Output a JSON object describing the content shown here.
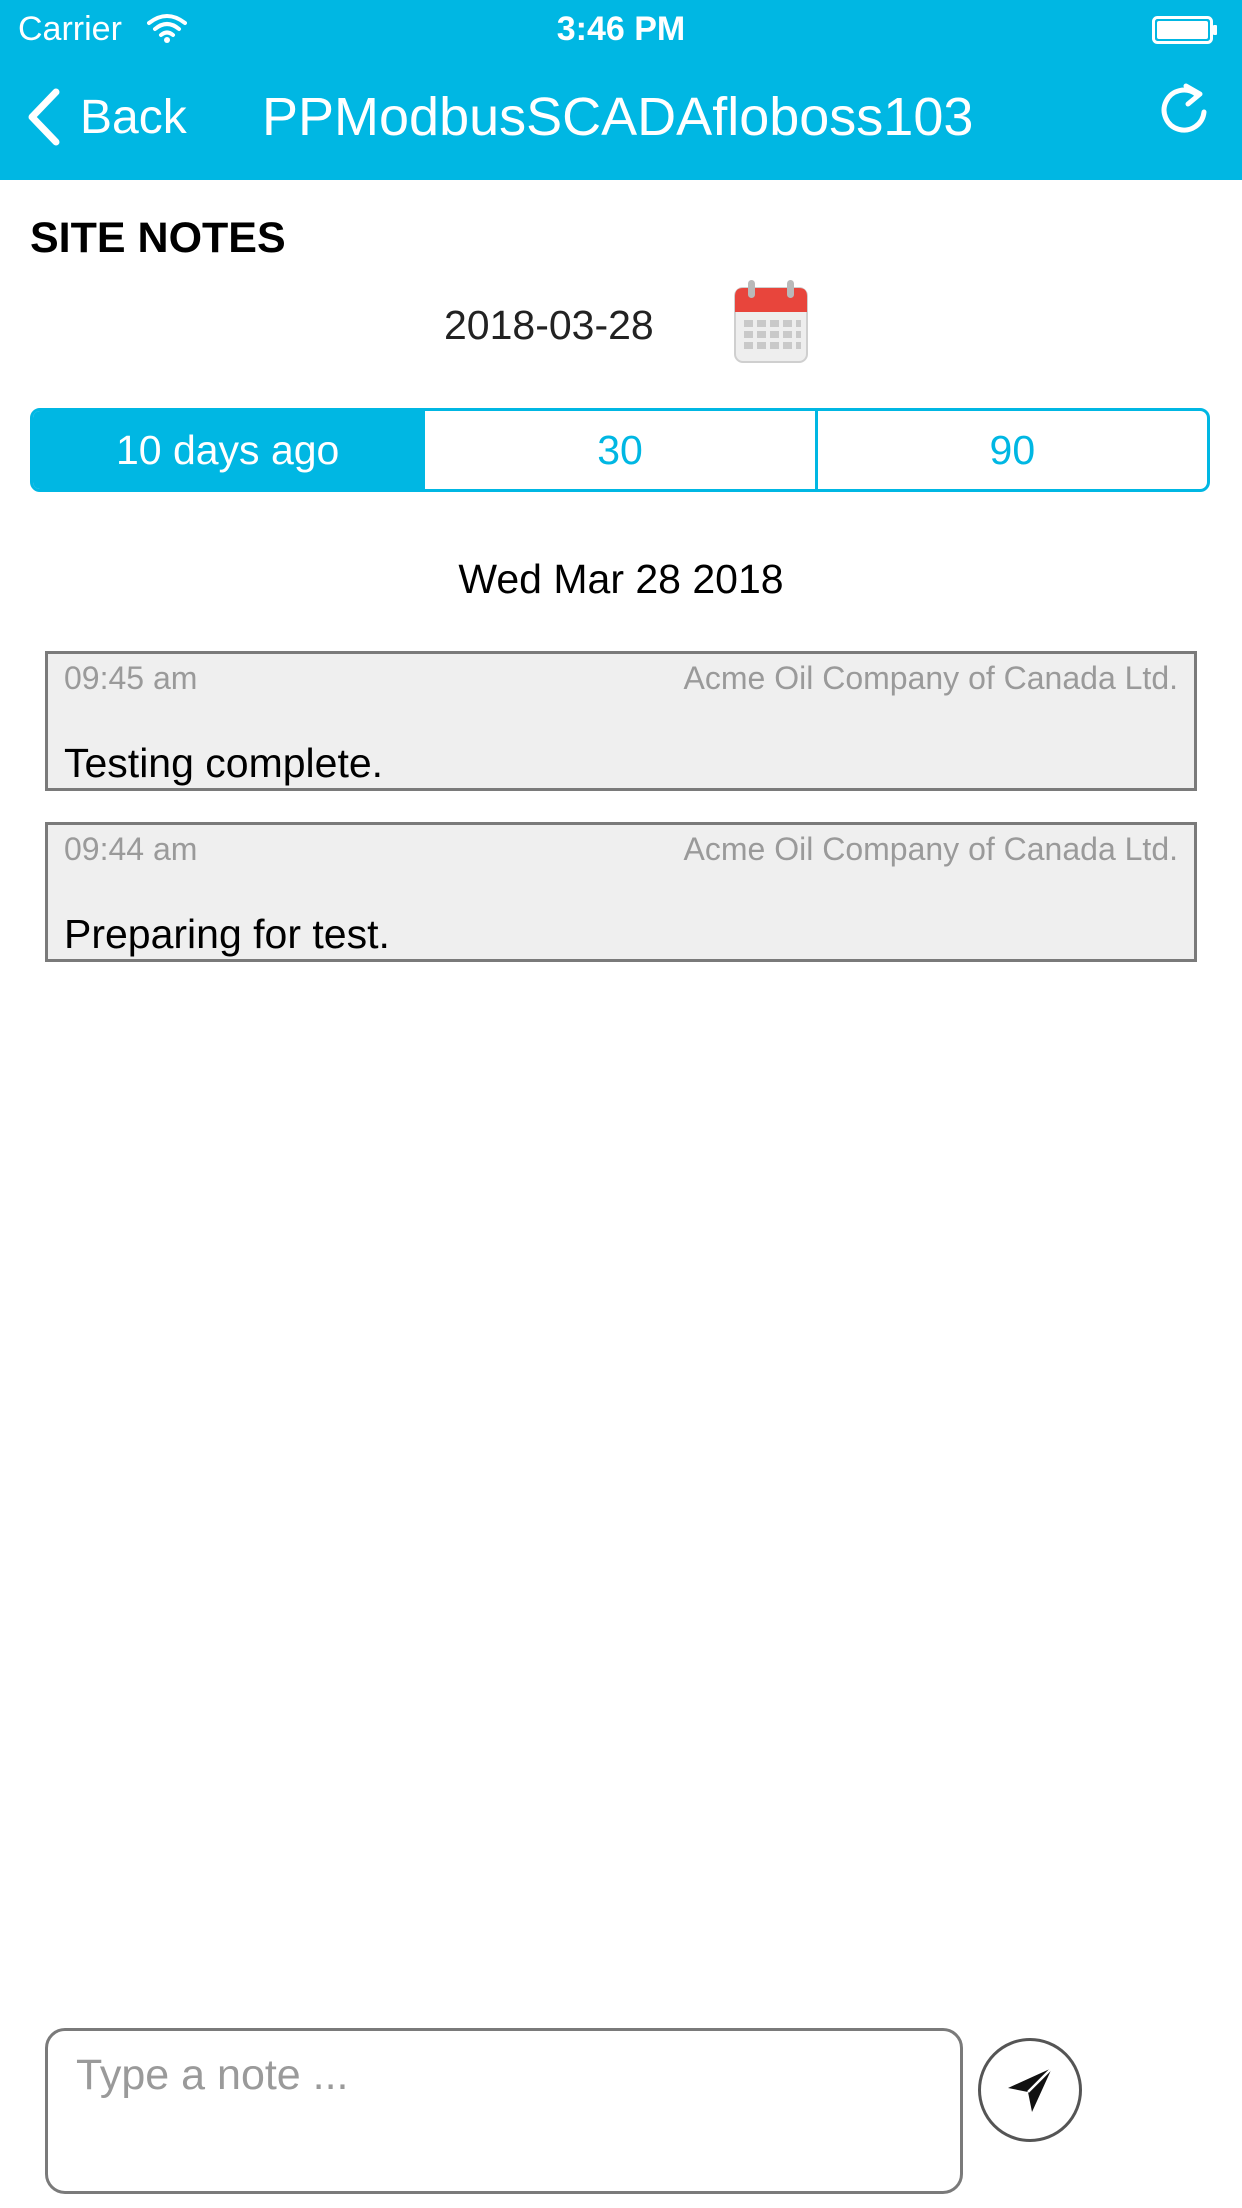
{
  "status_bar": {
    "carrier": "Carrier",
    "time": "3:46 PM"
  },
  "nav": {
    "back_label": "Back",
    "title": "PPModbusSCADAfloboss103",
    "icons": [
      "chevron-left-icon",
      "refresh-icon"
    ]
  },
  "header": {
    "section_title": "SITE NOTES",
    "selected_date": "2018-03-28",
    "calendar_icon": "calendar-icon"
  },
  "range_tabs": [
    {
      "label": "10 days ago",
      "selected": true
    },
    {
      "label": "30",
      "selected": false
    },
    {
      "label": "90",
      "selected": false
    }
  ],
  "notes_day": "Wed Mar 28 2018",
  "notes": [
    {
      "time": "09:45 am",
      "company": "Acme Oil Company of Canada Ltd.",
      "text": "Testing complete."
    },
    {
      "time": "09:44 am",
      "company": "Acme Oil Company of Canada Ltd.",
      "text": "Preparing for test."
    }
  ],
  "composer": {
    "placeholder": "Type a note ...",
    "send_icon": "send-icon"
  },
  "colors": {
    "accent": "#00b7e3",
    "note_bg": "#efefef",
    "note_border": "#7a7a7a",
    "muted_text": "#9a9a9a",
    "calendar_red": "#e8453c"
  }
}
